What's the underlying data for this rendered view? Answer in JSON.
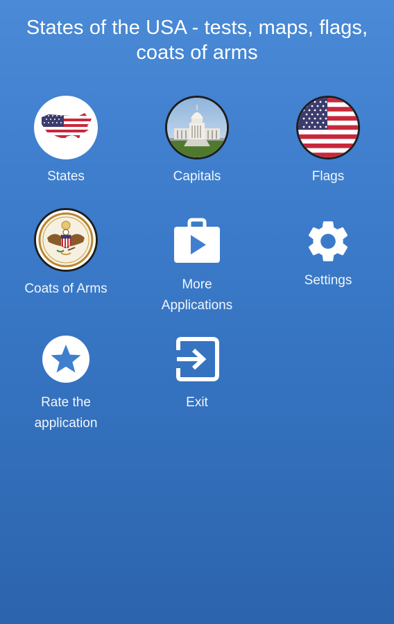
{
  "header": {
    "title_line1": "States of the USA - tests, maps, flags,",
    "title_line2": "coats of arms"
  },
  "menu": {
    "states": {
      "label": "States",
      "icon": "us-map-flag-icon"
    },
    "capitals": {
      "label": "Capitals",
      "icon": "capitol-building-icon"
    },
    "flags": {
      "label": "Flags",
      "icon": "us-flag-icon"
    },
    "coats": {
      "label": "Coats of Arms",
      "icon": "great-seal-icon"
    },
    "more_apps": {
      "label_line1": "More",
      "label_line2": "Applications",
      "icon": "play-store-icon"
    },
    "settings": {
      "label": "Settings",
      "icon": "gear-icon"
    },
    "rate": {
      "label_line1": "Rate the",
      "label_line2": "application",
      "icon": "star-icon"
    },
    "exit": {
      "label": "Exit",
      "icon": "exit-icon"
    }
  },
  "colors": {
    "background_top": "#4a8ad6",
    "background_bottom": "#2c64ad",
    "flag_red": "#c8283c",
    "flag_blue": "#3c3b6e"
  }
}
